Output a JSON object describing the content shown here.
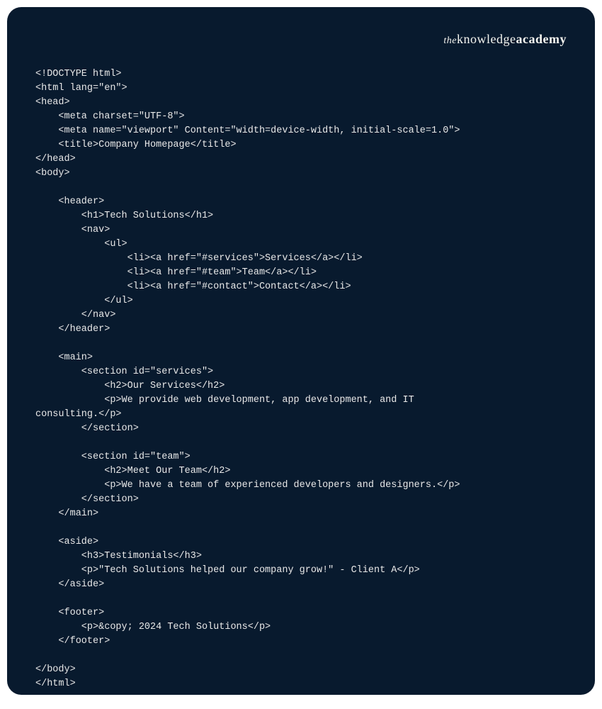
{
  "logo": {
    "the": "the",
    "knowledge": "knowledge",
    "academy": "academy"
  },
  "code": {
    "lines": [
      "<!DOCTYPE html>",
      "<html lang=\"en\">",
      "<head>",
      "    <meta charset=\"UTF-8\">",
      "    <meta name=\"viewport\" Content=\"width=device-width, initial-scale=1.0\">",
      "    <title>Company Homepage</title>",
      "</head>",
      "<body>",
      "",
      "    <header>",
      "        <h1>Tech Solutions</h1>",
      "        <nav>",
      "            <ul>",
      "                <li><a href=\"#services\">Services</a></li>",
      "                <li><a href=\"#team\">Team</a></li>",
      "                <li><a href=\"#contact\">Contact</a></li>",
      "            </ul>",
      "        </nav>",
      "    </header>",
      "",
      "    <main>",
      "        <section id=\"services\">",
      "            <h2>Our Services</h2>",
      "            <p>We provide web development, app development, and IT",
      "consulting.</p>",
      "        </section>",
      "",
      "        <section id=\"team\">",
      "            <h2>Meet Our Team</h2>",
      "            <p>We have a team of experienced developers and designers.</p>",
      "        </section>",
      "    </main>",
      "",
      "    <aside>",
      "        <h3>Testimonials</h3>",
      "        <p>\"Tech Solutions helped our company grow!\" - Client A</p>",
      "    </aside>",
      "",
      "    <footer>",
      "        <p>&copy; 2024 Tech Solutions</p>",
      "    </footer>",
      "",
      "</body>",
      "</html>"
    ]
  }
}
